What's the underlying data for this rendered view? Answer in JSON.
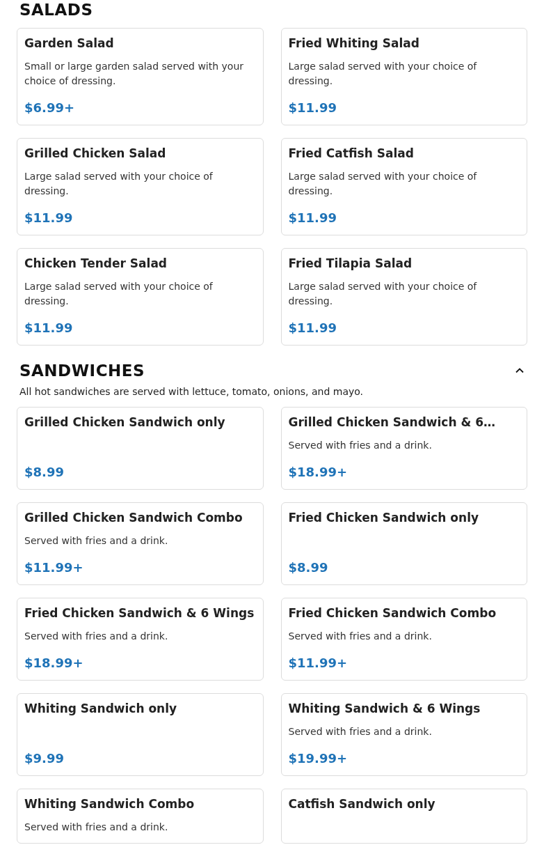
{
  "sections": [
    {
      "title": "SALADS",
      "items": [
        {
          "name": "Garden Salad",
          "description": "Small or large garden salad served with your choice of dressing.",
          "price": "$6.99+"
        },
        {
          "name": "Fried Whiting Salad",
          "description": "Large salad served with your choice of dressing.",
          "price": "$11.99"
        },
        {
          "name": "Grilled Chicken Salad",
          "description": "Large salad served with your choice of dressing.",
          "price": "$11.99"
        },
        {
          "name": "Fried Catfish Salad",
          "description": "Large salad served with your choice of dressing.",
          "price": "$11.99"
        },
        {
          "name": "Chicken Tender Salad",
          "description": "Large salad served with your choice of dressing.",
          "price": "$11.99"
        },
        {
          "name": "Fried Tilapia Salad",
          "description": "Large salad served with your choice of dressing.",
          "price": "$11.99"
        }
      ]
    },
    {
      "title": "SANDWICHES",
      "expanded": true,
      "note": "All hot sandwiches are served with lettuce, tomato, onions, and mayo.",
      "items": [
        {
          "name": "Grilled Chicken Sandwich only",
          "price": "$8.99"
        },
        {
          "name": "Grilled Chicken Sandwich & 6…",
          "description": "Served with fries and a drink.",
          "price": "$18.99+"
        },
        {
          "name": "Grilled Chicken Sandwich Combo",
          "description": "Served with fries and a drink.",
          "price": "$11.99+"
        },
        {
          "name": "Fried Chicken Sandwich only",
          "price": "$8.99"
        },
        {
          "name": "Fried Chicken Sandwich & 6 Wings",
          "description": "Served with fries and a drink.",
          "price": "$18.99+"
        },
        {
          "name": "Fried Chicken Sandwich Combo",
          "description": "Served with fries and a drink.",
          "price": "$11.99+"
        },
        {
          "name": "Whiting Sandwich only",
          "price": "$9.99"
        },
        {
          "name": "Whiting Sandwich & 6 Wings",
          "description": "Served with fries and a drink.",
          "price": "$19.99+"
        },
        {
          "name": "Whiting Sandwich Combo",
          "description": "Served with fries and a drink."
        },
        {
          "name": "Catfish Sandwich only"
        }
      ]
    }
  ]
}
